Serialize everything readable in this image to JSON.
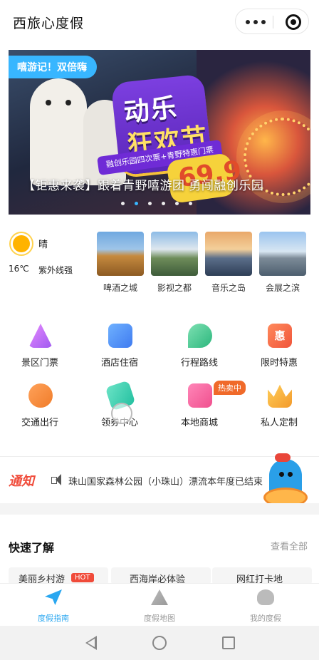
{
  "app": {
    "title": "西旅心度假"
  },
  "banner": {
    "tag": "嘻游记！双倍嗨",
    "poster_line1": "动乐",
    "poster_line2": "狂欢节",
    "strip": "融创乐园四次票+青野特惠门票",
    "price": "69.9",
    "caption": "【钜惠来袭】跟着青野嘻游团 勇闯融创乐园",
    "dots": 6,
    "active_dot": 1
  },
  "weather": {
    "condition": "晴",
    "temperature": "16℃",
    "uv": "紫外线强",
    "icon": "sun-icon"
  },
  "cities": [
    {
      "label": "啤酒之城"
    },
    {
      "label": "影视之都"
    },
    {
      "label": "音乐之岛"
    },
    {
      "label": "会展之滨"
    }
  ],
  "grid": [
    {
      "label": "景区门票",
      "icon": "ticket-icon"
    },
    {
      "label": "酒店住宿",
      "icon": "hotel-icon"
    },
    {
      "label": "行程路线",
      "icon": "route-icon"
    },
    {
      "label": "限时特惠",
      "icon": "sale-icon",
      "glyph": "惠"
    },
    {
      "label": "交通出行",
      "icon": "transport-icon"
    },
    {
      "label": "领券中心",
      "icon": "coupon-icon"
    },
    {
      "label": "本地商城",
      "icon": "gift-icon",
      "badge": "热卖中"
    },
    {
      "label": "私人定制",
      "icon": "crown-icon"
    }
  ],
  "notice": {
    "tag": "通知",
    "text": "珠山国家森林公园（小珠山）漂流本年度已结束"
  },
  "quick": {
    "title": "快速了解",
    "more": "查看全部",
    "chips": [
      {
        "label": "美丽乡村游",
        "badge": "HOT"
      },
      {
        "label": "西海岸必体验"
      },
      {
        "label": "网红打卡地"
      }
    ]
  },
  "tabs": [
    {
      "label": "度假指南",
      "icon": "paper-plane-icon",
      "active": true
    },
    {
      "label": "度假地图",
      "icon": "map-icon",
      "active": false
    },
    {
      "label": "我的度假",
      "icon": "user-icon",
      "active": false
    }
  ],
  "colors": {
    "accent": "#2aa7f0",
    "notice": "#f04b3a",
    "hot": "#f06a2a"
  }
}
